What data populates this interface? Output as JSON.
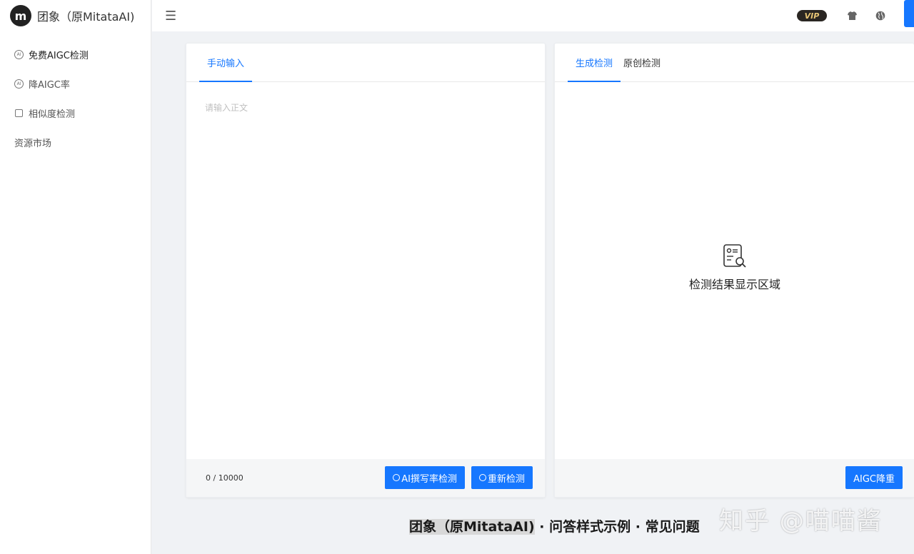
{
  "brand": {
    "logo_letter": "m",
    "name": "团象（原MitataAI)"
  },
  "sidebar": {
    "items": [
      {
        "label": "免费AIGC检测",
        "icon": "ai-circle-icon",
        "active": true
      },
      {
        "label": "降AIGC率",
        "icon": "ai-circle-icon",
        "active": false
      },
      {
        "label": "相似度检测",
        "icon": "square-icon",
        "active": false
      },
      {
        "label": "资源市场",
        "icon": "",
        "active": false
      }
    ]
  },
  "header": {
    "menu_icon": "☰",
    "vip_label": "VIP"
  },
  "left_panel": {
    "tab": "手动输入",
    "placeholder": "请输入正文",
    "count": "0 / 10000",
    "btn_detect": "AI撰写率检测",
    "btn_redetect": "重新检测"
  },
  "right_panel": {
    "tabs": [
      "生成检测",
      "原创检测"
    ],
    "result_text": "检测结果显示区域",
    "btn_reduce": "AIGC降重"
  },
  "caption": {
    "highlight": "团象（原MitataAI)",
    "rest": " · 问答样式示例 · 常见问题"
  },
  "watermark": "知乎 @喵喵酱",
  "colors": {
    "accent": "#1677ff",
    "vip_bg": "#2a2622",
    "vip_text": "#e8c676"
  }
}
